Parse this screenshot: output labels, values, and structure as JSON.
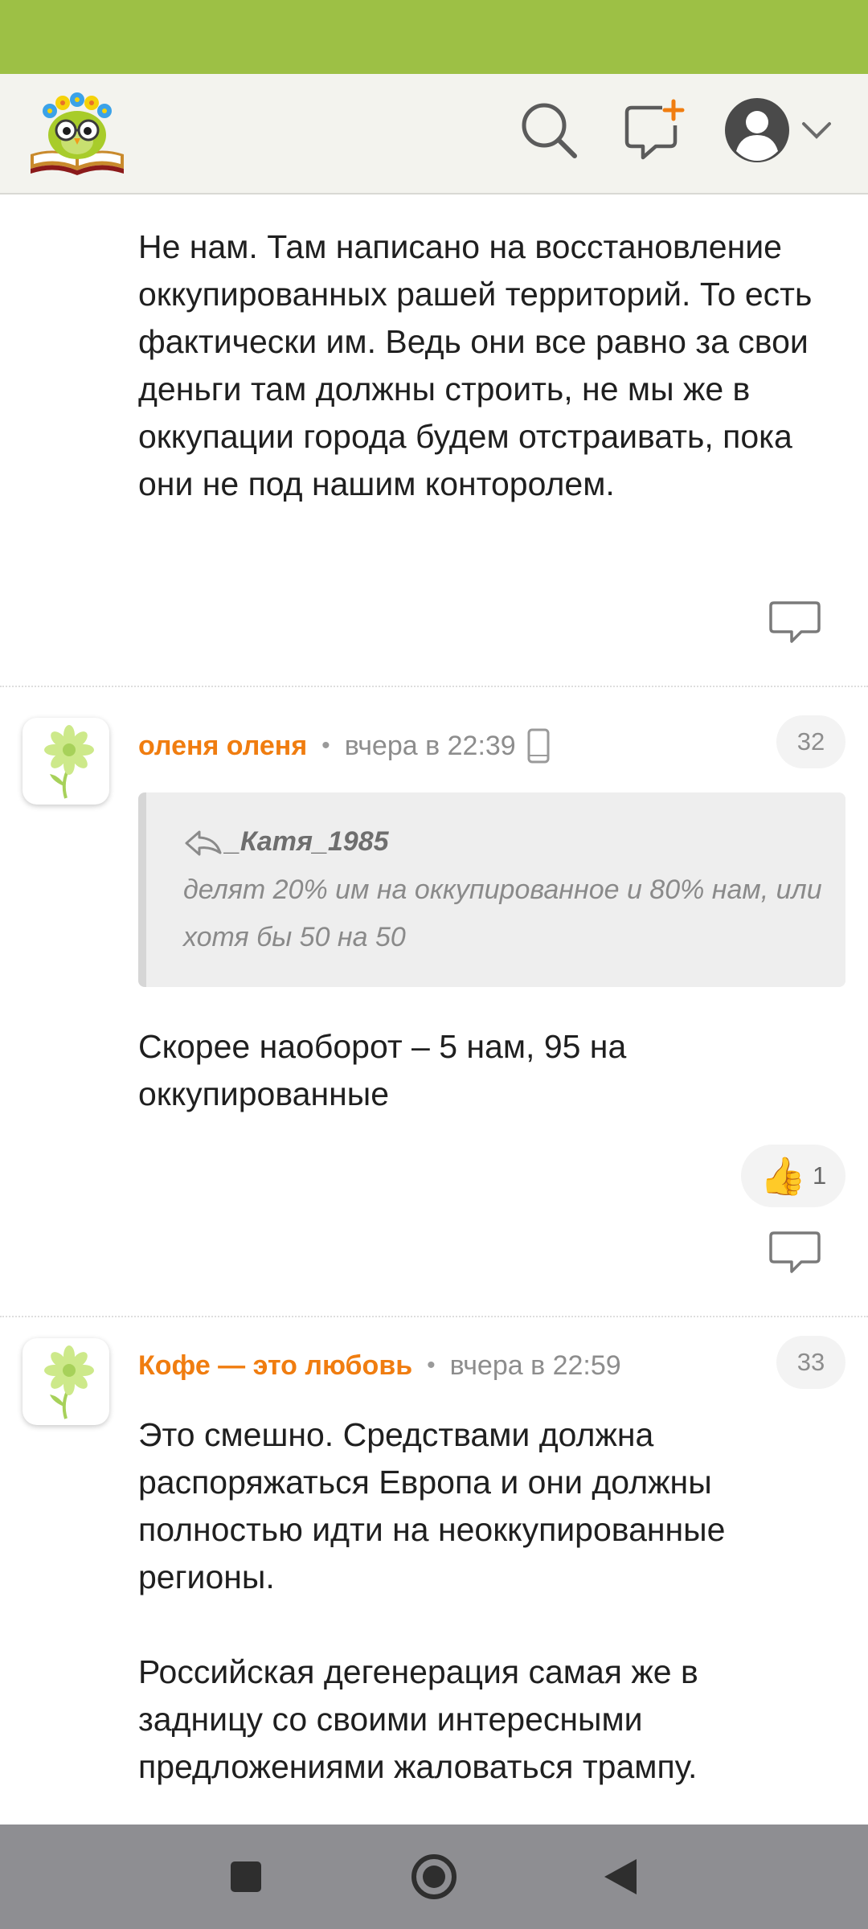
{
  "header": {
    "logo_icon": "owl-on-book-logo-icon",
    "search_icon": "search-icon",
    "new_post_icon": "new-post-icon",
    "profile_icon": "user-avatar-icon",
    "chevron_icon": "chevron-down-icon"
  },
  "comments": [
    {
      "body": "Не нам. Там написано на восстановление оккупированных рашей территорий. То есть фактически им. Ведь они все равно за свои деньги там должны строить, не мы же в оккупации города будем отстраивать, пока они не под нашим конторолем.",
      "reply_icon": "reply-icon"
    },
    {
      "author": "оленя оленя",
      "separator": "•",
      "time": "вчера в 22:39",
      "device_icon": "mobile-phone-icon",
      "number": "32",
      "quote": {
        "author": "_Катя_1985",
        "text": "делят 20% им на оккупированное и 80% нам, или хотя бы 50 на 50"
      },
      "body": "Скорее наоборот – 5 нам, 95 на оккупированные",
      "like": {
        "emoji": "👍",
        "count": "1"
      },
      "reply_icon": "reply-icon"
    },
    {
      "author": "Кофе — это любовь",
      "separator": "•",
      "time": "вчера в 22:59",
      "number": "33",
      "body_p1": "Это смешно. Средствами должна распоряжаться Европа и они должны полностью идти на неоккупированные регионы.",
      "body_p2": "Российская дегенерация самая же в задницу со своими интересными предложениями жаловаться трампу."
    }
  ],
  "nav": {
    "recents_icon": "square-recents-icon",
    "home_icon": "circle-home-icon",
    "back_icon": "triangle-back-icon"
  },
  "colors": {
    "status_bar": "#9dc045",
    "header_bg": "#f3f3ee",
    "author": "#f07d10",
    "nav_bar": "#8e8e92"
  }
}
